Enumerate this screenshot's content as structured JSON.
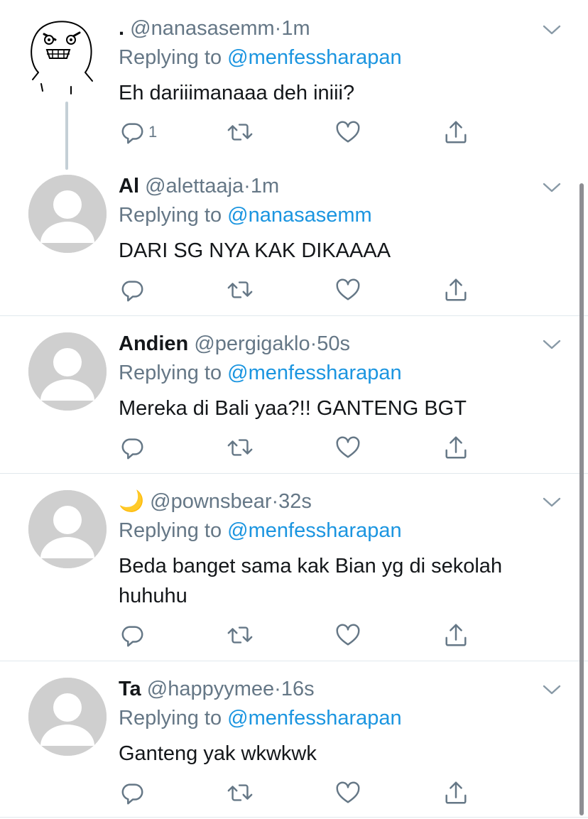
{
  "tweets": [
    {
      "name": ".",
      "handle": "@nanasasemm",
      "dot": "·",
      "time": "1m",
      "replying_label": "Replying to",
      "replying_to": "@menfessharapan",
      "text": "Eh dariiimanaaa deh iniii?",
      "reply_count": "1",
      "avatar": "meme-face"
    },
    {
      "name": "Al",
      "handle": "@alettaaja",
      "dot": "·",
      "time": "1m",
      "replying_label": "Replying to",
      "replying_to": "@nanasasemm",
      "text": "DARI SG NYA KAK DIKAAAA",
      "reply_count": "",
      "avatar": "default"
    },
    {
      "name": "Andien",
      "handle": "@pergigaklo",
      "dot": "·",
      "time": "50s",
      "replying_label": "Replying to",
      "replying_to": "@menfessharapan",
      "text": "Mereka di Bali yaa?!! GANTENG BGT",
      "reply_count": "",
      "avatar": "default"
    },
    {
      "name": "🌙",
      "handle": "@pownsbear",
      "dot": "·",
      "time": "32s",
      "replying_label": "Replying to",
      "replying_to": "@menfessharapan",
      "text": "Beda banget sama kak Bian yg di sekolah huhuhu",
      "reply_count": "",
      "avatar": "default"
    },
    {
      "name": "Ta",
      "handle": "@happyymee",
      "dot": "·",
      "time": "16s",
      "replying_label": "Replying to",
      "replying_to": "@menfessharapan",
      "text": "Ganteng yak wkwkwk",
      "reply_count": "",
      "avatar": "default"
    }
  ],
  "icons": {
    "reply": "reply-icon",
    "retweet": "retweet-icon",
    "like": "heart-icon",
    "share": "share-icon",
    "menu": "chevron-down-icon"
  },
  "colors": {
    "text": "#14171a",
    "secondary": "#657786",
    "mention": "#1b95e0",
    "divider": "#e1e8ed",
    "avatar_bg": "#cfcfcf"
  }
}
